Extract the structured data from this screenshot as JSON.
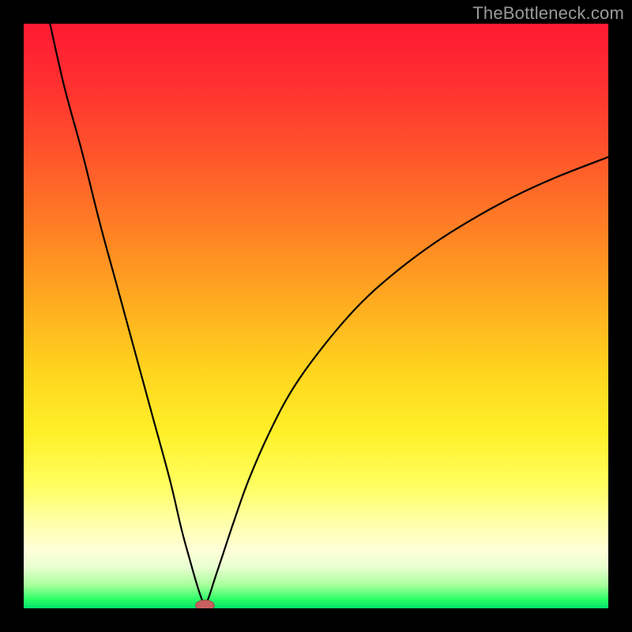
{
  "watermark": "TheBottleneck.com",
  "colors": {
    "frame": "#000000",
    "curve": "#000000",
    "marker_fill": "#c9605f",
    "marker_stroke": "#9e4a49"
  },
  "chart_data": {
    "type": "line",
    "title": "",
    "xlabel": "",
    "ylabel": "",
    "xlim": [
      0,
      100
    ],
    "ylim": [
      0,
      100
    ],
    "grid": false,
    "legend": false,
    "bottleneck_x": 31,
    "marker": {
      "x": 31,
      "y": 0.5,
      "rx": 1.6,
      "ry": 0.9
    },
    "left_branch": {
      "x": [
        4.5,
        7,
        10,
        13,
        16,
        19,
        22,
        25,
        27,
        28.5,
        29.5,
        30.3,
        31
      ],
      "y": [
        100,
        89,
        78,
        66,
        55,
        44,
        33,
        22,
        13.5,
        8,
        4.5,
        2,
        0.4
      ]
    },
    "right_branch": {
      "x": [
        31,
        31.7,
        32.6,
        34,
        36,
        38.5,
        42,
        46,
        51,
        57,
        63,
        70,
        77,
        84,
        91,
        100
      ],
      "y": [
        0.4,
        2,
        4.8,
        9,
        15,
        22,
        30,
        37.5,
        44.5,
        51.5,
        57,
        62.3,
        66.7,
        70.5,
        73.7,
        77.2
      ]
    }
  }
}
